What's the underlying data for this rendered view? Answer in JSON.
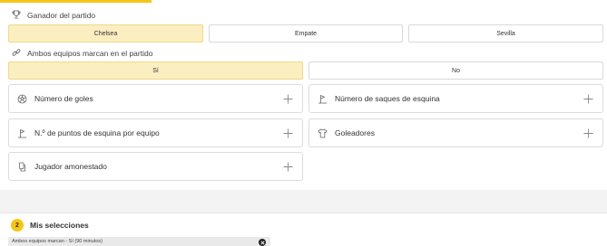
{
  "match_winner": {
    "title": "Ganador del partido",
    "icon": "trophy-icon",
    "options": [
      {
        "label": "Chelsea",
        "selected": true
      },
      {
        "label": "Empate",
        "selected": false
      },
      {
        "label": "Sevilla",
        "selected": false
      }
    ]
  },
  "both_teams_score": {
    "title": "Ambos equipos marcan en el partido",
    "icon": "link-icon",
    "options": [
      {
        "label": "Sí",
        "selected": true
      },
      {
        "label": "No",
        "selected": false
      }
    ]
  },
  "markets": [
    {
      "label": "Número de goles",
      "icon": "football-icon"
    },
    {
      "label": "Número de saques de esquina",
      "icon": "corner-flag-icon"
    },
    {
      "label": "N.º de puntos de esquina por equipo",
      "icon": "corner-flag-icon"
    },
    {
      "label": "Goleadores",
      "icon": "jersey-icon"
    },
    {
      "label": "Jugador amonestado",
      "icon": "card-icon"
    }
  ],
  "selections": {
    "count": "2",
    "title": "Mis selecciones",
    "items": [
      {
        "label": "Ambos equipos marcan - Sí (90 minutos)"
      }
    ]
  },
  "colors": {
    "accent": "#f5c518",
    "selected_bg": "#fbeec1"
  }
}
